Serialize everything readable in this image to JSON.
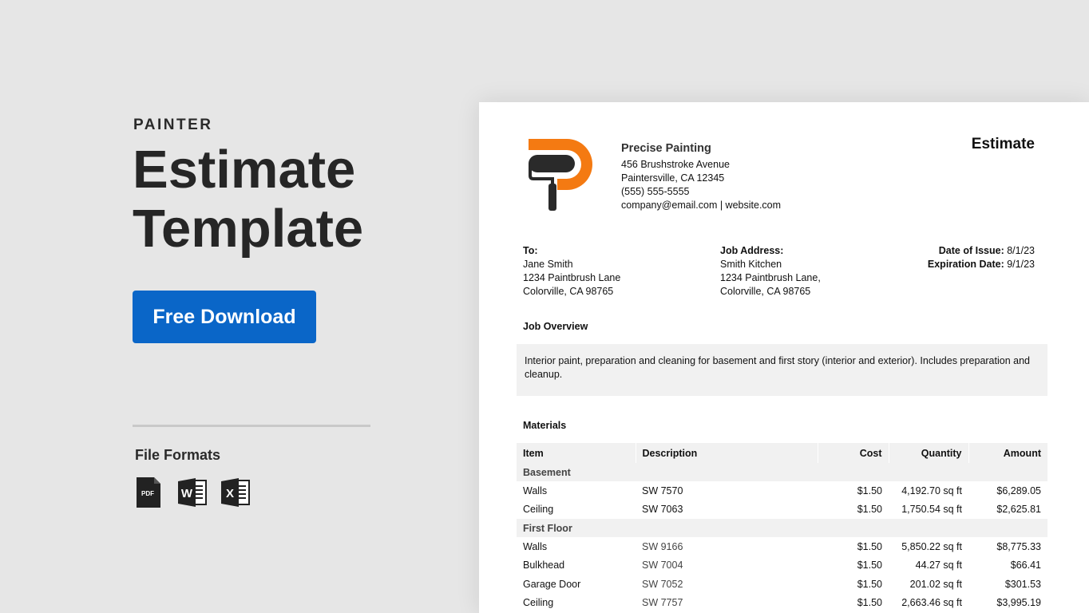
{
  "promo": {
    "eyebrow": "PAINTER",
    "title_line1": "Estimate",
    "title_line2": "Template",
    "download_label": "Free Download",
    "file_formats_label": "File Formats",
    "formats": [
      "PDF",
      "W",
      "X"
    ]
  },
  "doc": {
    "company": {
      "name": "Precise Painting",
      "street": "456 Brushstroke Avenue",
      "city": "Paintersville, CA 12345",
      "phone": "(555) 555-5555",
      "contact": "company@email.com | website.com"
    },
    "title": "Estimate",
    "to": {
      "label": "To:",
      "name": "Jane Smith",
      "street": "1234 Paintbrush Lane",
      "city": "Colorville, CA 98765"
    },
    "job_address": {
      "label": "Job Address:",
      "name": "Smith Kitchen",
      "street": "1234 Paintbrush Lane,",
      "city": "Colorville, CA 98765"
    },
    "dates": {
      "issue_label": "Date of Issue:",
      "issue_value": "8/1/23",
      "expiration_label": "Expiration Date:",
      "expiration_value": "9/1/23"
    },
    "overview": {
      "heading": "Job Overview",
      "text": "Interior paint, preparation and cleaning for basement and first story (interior and exterior). Includes preparation and cleanup."
    },
    "materials": {
      "heading": "Materials",
      "columns": [
        "Item",
        "Description",
        "Cost",
        "Quantity",
        "Amount"
      ],
      "sections": [
        {
          "name": "Basement",
          "rows": [
            [
              "Walls",
              "SW 7570",
              "$1.50",
              "4,192.70 sq ft",
              "$6,289.05"
            ],
            [
              "Ceiling",
              "SW 7063",
              "$1.50",
              "1,750.54 sq ft",
              "$2,625.81"
            ]
          ]
        },
        {
          "name": "First Floor",
          "rows": [
            [
              "Walls",
              "SW 9166",
              "$1.50",
              "5,850.22 sq ft",
              "$8,775.33"
            ],
            [
              "Bulkhead",
              "SW 7004",
              "$1.50",
              "44.27 sq ft",
              "$66.41"
            ],
            [
              "Garage Door",
              "SW 7052",
              "$1.50",
              "201.02 sq ft",
              "$301.53"
            ],
            [
              "Ceiling",
              "SW 7757",
              "$1.50",
              "2,663.46 sq ft",
              "$3,995.19"
            ]
          ]
        }
      ]
    }
  },
  "colors": {
    "background": "#e6e6e6",
    "button": "#0a66c8",
    "logo_accent": "#f47a12",
    "icon_dark": "#222222"
  }
}
